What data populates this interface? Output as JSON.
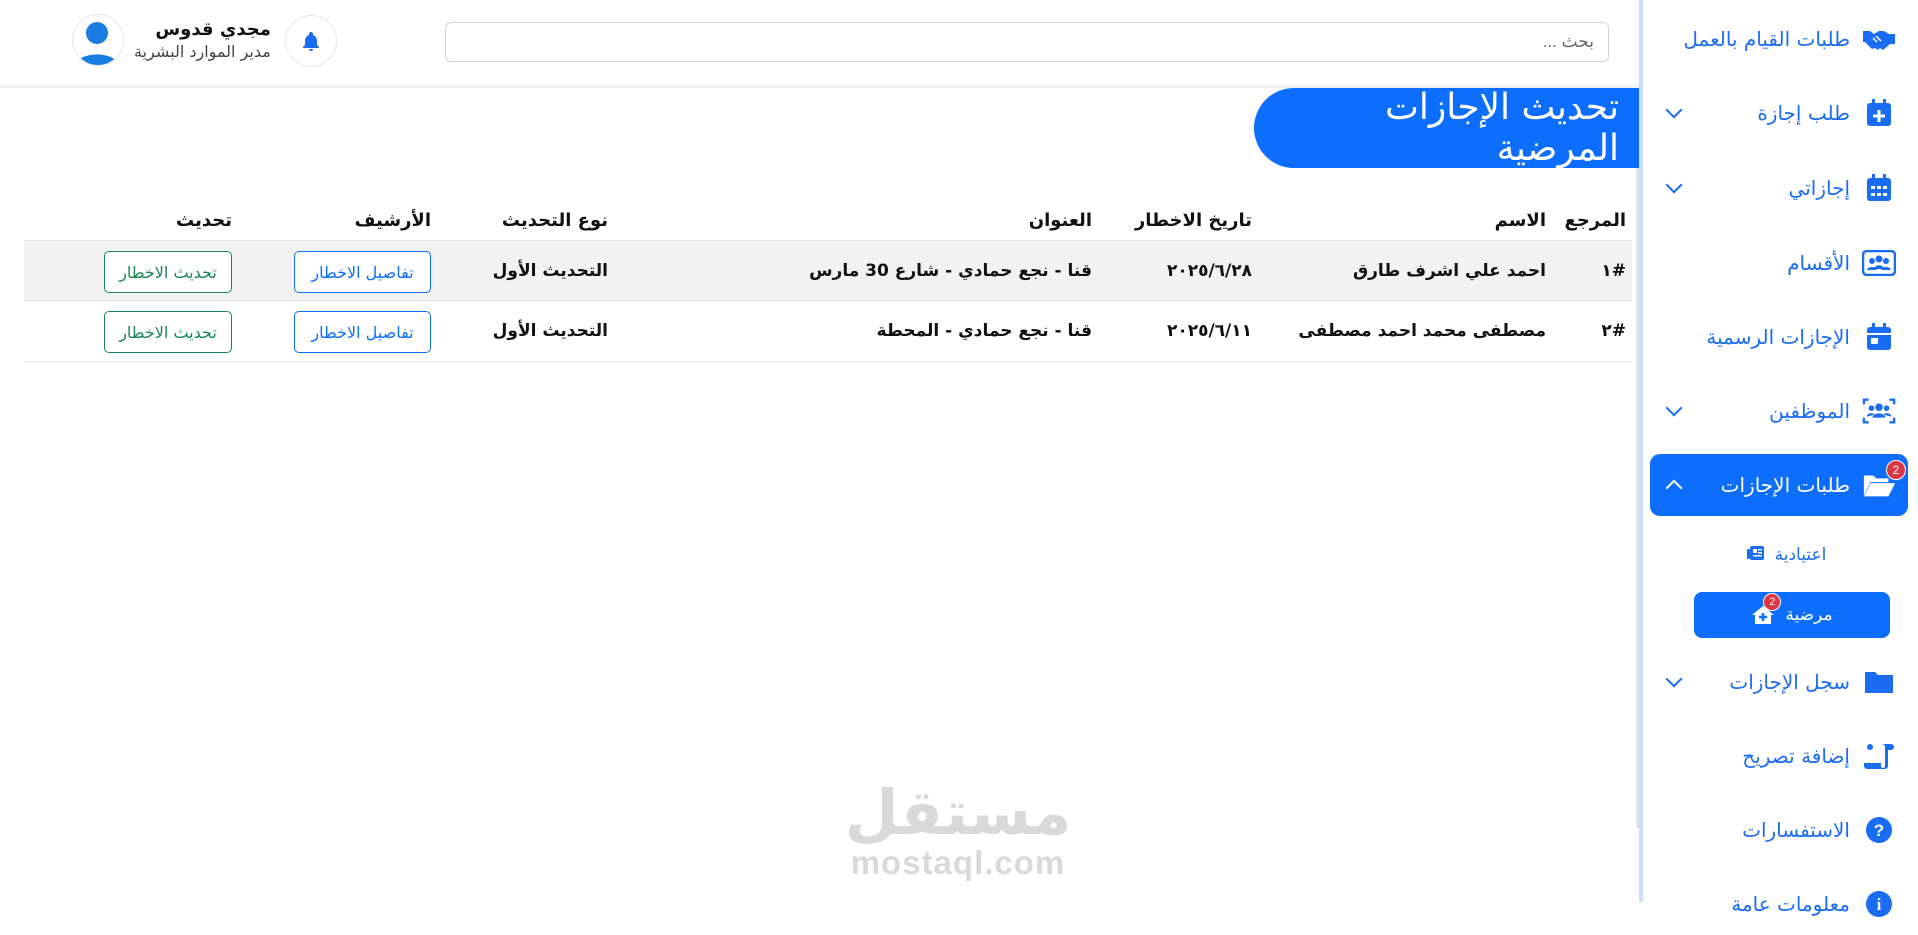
{
  "sidebar": {
    "items": [
      {
        "label": "طلبات القيام بالعمل",
        "icon": "handshake-icon"
      },
      {
        "label": "طلب إجازة",
        "icon": "calendar-plus-icon"
      },
      {
        "label": "إجازاتي",
        "icon": "calendar-icon"
      },
      {
        "label": "الأقسام",
        "icon": "id-card-icon"
      },
      {
        "label": "الإجازات الرسمية",
        "icon": "calendar-day-icon"
      },
      {
        "label": "الموظفين",
        "icon": "users-icon"
      },
      {
        "label": "طلبات الإجازات",
        "icon": "folder-open-icon",
        "badge": "2"
      },
      {
        "label": "سجل الإجازات",
        "icon": "folder-icon"
      },
      {
        "label": "إضافة تصريح",
        "icon": "scroll-icon"
      },
      {
        "label": "الاستفسارات",
        "icon": "question-circle-icon"
      },
      {
        "label": "معلومات عامة",
        "icon": "info-circle-icon"
      }
    ],
    "subitems": [
      {
        "label": "اعتيادية",
        "icon": "newspaper-icon"
      },
      {
        "label": "مرضية",
        "icon": "house-medical-icon",
        "badge": "2"
      }
    ]
  },
  "topbar": {
    "search_placeholder": "بحث ...",
    "user_name": "مجدي قدوس",
    "user_role": "مدير الموارد البشرية"
  },
  "page": {
    "title": "تحديث الإجازات المرضية"
  },
  "table": {
    "headers": {
      "ref": "المرجع",
      "name": "الاسم",
      "date": "تاريخ الاخطار",
      "address": "العنوان",
      "update_type": "نوع التحديث",
      "archive": "الأرشيف",
      "update": "تحديث"
    },
    "rows": [
      {
        "ref": "#١",
        "name": "احمد علي اشرف طارق",
        "date": "٢٠٢٥/٦/٢٨",
        "address": "قنا - نجع حمادي - شارع 30 مارس",
        "update_type": "التحديث الأول",
        "archive_btn": "تفاصيل الاخطار",
        "update_btn": "تحديث الاخطار"
      },
      {
        "ref": "#٢",
        "name": "مصطفى محمد احمد مصطفى",
        "date": "٢٠٢٥/٦/١١",
        "address": "قنا - نجع حمادي - المحطة",
        "update_type": "التحديث الأول",
        "archive_btn": "تفاصيل الاخطار",
        "update_btn": "تحديث الاخطار"
      }
    ]
  },
  "watermark": {
    "arabic": "مستقل",
    "latin": "mostaql.com"
  },
  "colors": {
    "primary": "#0d6efd",
    "success": "#198754",
    "danger": "#dc3545"
  }
}
